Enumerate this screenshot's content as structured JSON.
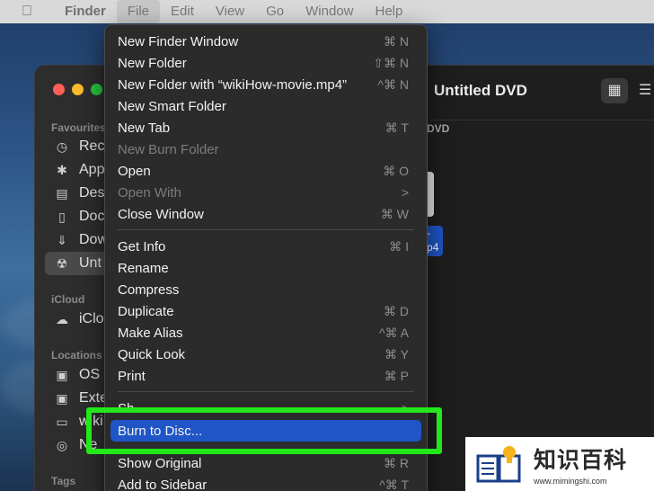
{
  "menubar": {
    "items": [
      "Finder",
      "File",
      "Edit",
      "View",
      "Go",
      "Window",
      "Help"
    ]
  },
  "finder": {
    "title": "Untitled DVD",
    "path_label": "DVD",
    "sidebar": {
      "favourites_header": "Favourites",
      "favourites": [
        "Rec",
        "App",
        "Des",
        "Doc",
        "Dow",
        "Unt"
      ],
      "icloud_header": "iCloud",
      "icloud": [
        "iClo"
      ],
      "locations_header": "Locations",
      "locations": [
        "OS",
        "Exte",
        "wiki",
        "Ne"
      ],
      "tags_header": "Tags"
    },
    "file_label": "-\np4"
  },
  "menu": {
    "items": [
      {
        "label": "New Finder Window",
        "shortcut": "⌘ N",
        "enabled": true
      },
      {
        "label": "New Folder",
        "shortcut": "⇧⌘ N",
        "enabled": true
      },
      {
        "label": "New Folder with “wikiHow-movie.mp4”",
        "shortcut": "^⌘ N",
        "enabled": true
      },
      {
        "label": "New Smart Folder",
        "shortcut": "",
        "enabled": true
      },
      {
        "label": "New Tab",
        "shortcut": "⌘ T",
        "enabled": true
      },
      {
        "label": "New Burn Folder",
        "shortcut": "",
        "enabled": false
      },
      {
        "label": "Open",
        "shortcut": "⌘ O",
        "enabled": true
      },
      {
        "label": "Open With",
        "shortcut": ">",
        "enabled": false
      },
      {
        "label": "Close Window",
        "shortcut": "⌘ W",
        "enabled": true
      },
      {
        "label": "Get Info",
        "shortcut": "⌘ I",
        "enabled": true
      },
      {
        "label": "Rename",
        "shortcut": "",
        "enabled": true
      },
      {
        "label": "Compress",
        "shortcut": "",
        "enabled": true
      },
      {
        "label": "Duplicate",
        "shortcut": "⌘ D",
        "enabled": true
      },
      {
        "label": "Make Alias",
        "shortcut": "^⌘ A",
        "enabled": true
      },
      {
        "label": "Quick Look",
        "shortcut": "⌘ Y",
        "enabled": true
      },
      {
        "label": "Print",
        "shortcut": "⌘ P",
        "enabled": true
      },
      {
        "label": "Sh",
        "shortcut": ">",
        "enabled": true
      },
      {
        "label": "Burn to Disc...",
        "shortcut": "",
        "enabled": true,
        "highlighted": true
      },
      {
        "label": "Show Original",
        "shortcut": "⌘ R",
        "enabled": true
      },
      {
        "label": "Add to Sidebar",
        "shortcut": "^⌘ T",
        "enabled": true
      }
    ]
  },
  "watermark": {
    "chinese": "知识百科",
    "url": "www.mimingshi.com"
  },
  "colors": {
    "highlight": "#1f55c6",
    "annotation_box": "#22e81a"
  }
}
